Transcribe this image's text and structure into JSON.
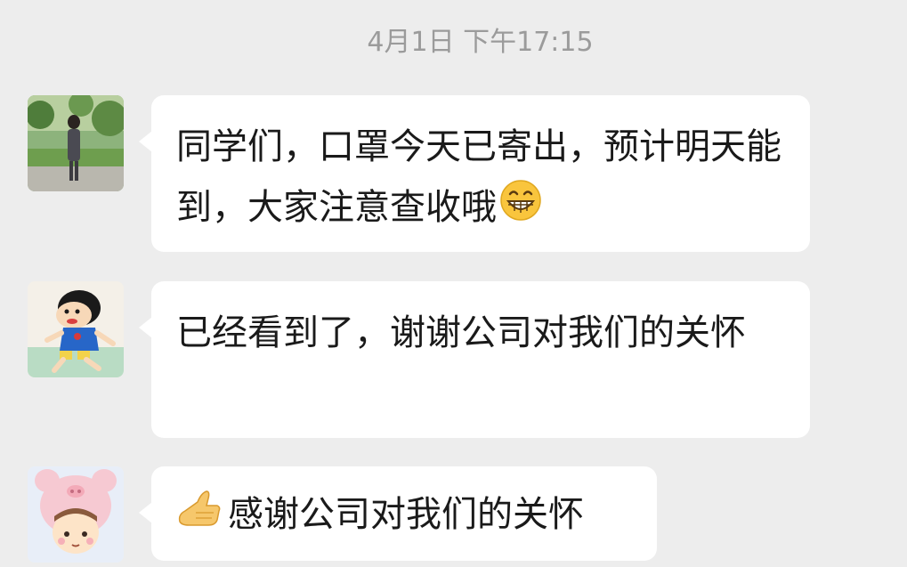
{
  "chat": {
    "timestamp": "4月1日 下午17:15",
    "messages": [
      {
        "avatar_icon": "girl-photo-avatar-icon",
        "text": "同学们，口罩今天已寄出，预计明天能到，大家注意查收哦",
        "emoji": "grin-emoji-icon"
      },
      {
        "avatar_icon": "crayon-shinchan-avatar-icon",
        "text": "已经看到了，谢谢公司对我们的关怀"
      },
      {
        "avatar_icon": "cartoon-pig-hat-girl-avatar-icon",
        "text": "感谢公司对我们的关怀",
        "emoji": "thumb-up-hand-emoji-icon"
      }
    ]
  }
}
